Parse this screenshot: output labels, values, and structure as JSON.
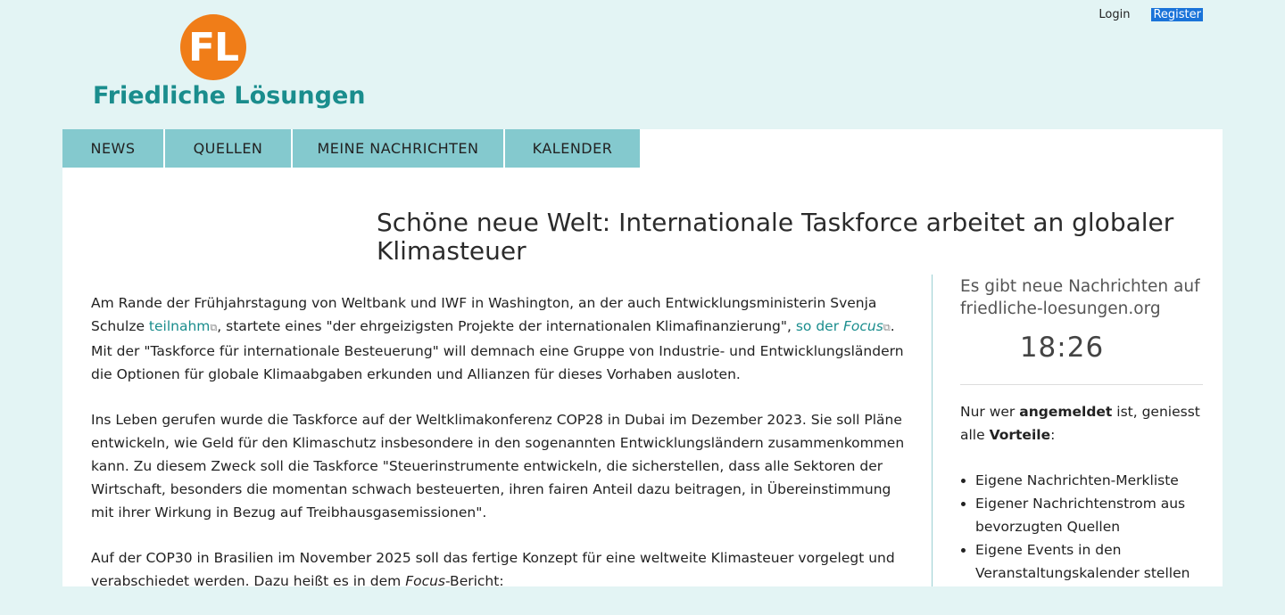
{
  "header": {
    "login_label": "Login",
    "register_label": "Register",
    "logo_mark": "FL",
    "logo_text": "Friedliche Lösungen"
  },
  "nav": {
    "items": [
      "NEWS",
      "QUELLEN",
      "MEINE NACHRICHTEN",
      "KALENDER"
    ]
  },
  "article": {
    "title": "Schöne neue Welt: Internationale Taskforce arbeitet an globaler Klimasteuer",
    "p1_a": "Am Rande der Frühjahrstagung von Weltbank und IWF in Washington, an der auch Entwicklungsministerin Svenja Schulze ",
    "p1_link1": "teilnahm",
    "p1_b": ", startete eines \"der ehrgeizigsten Projekte der internationalen Klimafinanzierung\", ",
    "p1_link2_pre": "so der ",
    "p1_link2_em": "Focus",
    "p1_c": ". Mit der \"Taskforce für internationale Besteuerung\" will demnach eine Gruppe von Industrie- und Entwicklungsländern die Optionen für globale Klimaabgaben erkunden und Allianzen für dieses Vorhaben ausloten.",
    "p2": "Ins Leben gerufen wurde die Taskforce auf der Weltklimakonferenz COP28 in Dubai im Dezember 2023. Sie soll Pläne entwickeln, wie Geld für den Klimaschutz insbesondere in den sogenannten Entwicklungsländern zusammenkommen kann. Zu diesem Zweck soll die Taskforce \"Steuerinstrumente entwickeln, die sicherstellen, dass alle Sektoren der Wirtschaft, besonders die momentan schwach besteuerten, ihren fairen Anteil dazu beitragen, in Übereinstimmung mit ihrer Wirkung in Bezug auf Treibhausgasemissionen\".",
    "p3_a": "Auf der COP30 in Brasilien im November 2025 soll das fertige Konzept für eine weltweite Klimasteuer vorgelegt und verabschiedet werden. Dazu heißt es in dem ",
    "p3_em": "Focus",
    "p3_b": "-Bericht:"
  },
  "sidebar": {
    "news_notice": "Es gibt neue Nachrichten auf friedliche-loesungen.org",
    "time": "18:26",
    "info_a": "Nur wer ",
    "info_strong1": "angemeldet",
    "info_b": " ist, geniesst alle ",
    "info_strong2": "Vorteile",
    "info_c": ":",
    "benefits": [
      "Eigene Nachrichten-Merkliste",
      "Eigener Nachrichtenstrom aus bevorzugten Quellen",
      "Eigene Events in den Veranstaltungskalender stellen"
    ]
  }
}
